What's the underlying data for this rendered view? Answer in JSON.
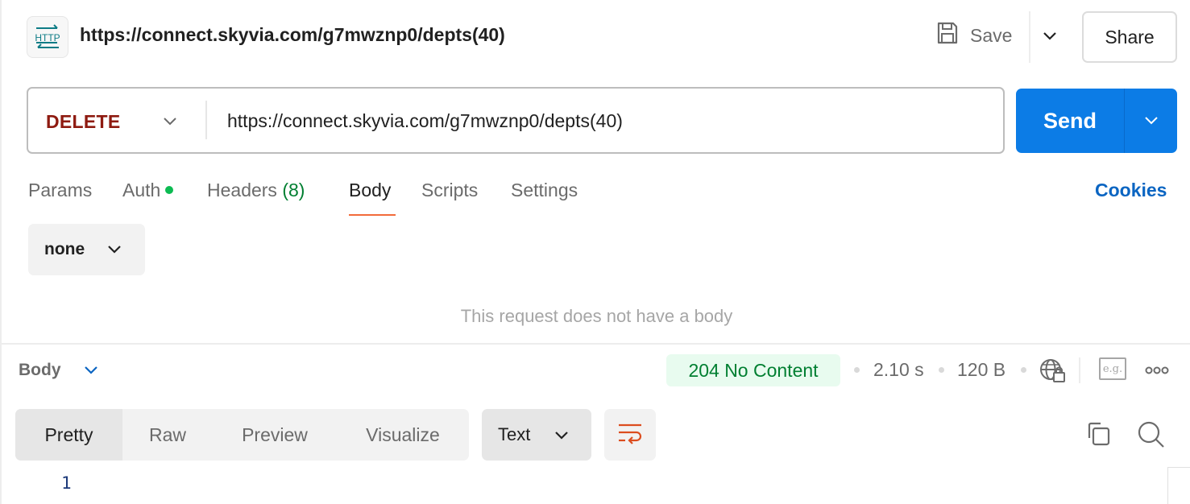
{
  "header": {
    "icon_label": "HTTP",
    "title": "https://connect.skyvia.com/g7mwznp0/depts(40)",
    "save_label": "Save",
    "share_label": "Share"
  },
  "request": {
    "method": "DELETE",
    "url": "https://connect.skyvia.com/g7mwznp0/depts(40)",
    "send_label": "Send"
  },
  "tabs": [
    {
      "label": "Params"
    },
    {
      "label": "Auth",
      "indicator": "green-dot"
    },
    {
      "label": "Headers",
      "count": "(8)"
    },
    {
      "label": "Body",
      "active": true
    },
    {
      "label": "Scripts"
    },
    {
      "label": "Settings"
    }
  ],
  "cookies_label": "Cookies",
  "body_type": {
    "selected": "none",
    "empty_message": "This request does not have a body"
  },
  "response": {
    "section_label": "Body",
    "status": "204 No Content",
    "time": "2.10 s",
    "size": "120 B",
    "view_tabs": [
      {
        "label": "Pretty",
        "active": true
      },
      {
        "label": "Raw"
      },
      {
        "label": "Preview"
      },
      {
        "label": "Visualize"
      }
    ],
    "format": "Text",
    "example_label": "e.g.",
    "lines": [
      "1"
    ]
  },
  "colors": {
    "method_delete": "#8e1a10",
    "send_button": "#0c7ce6",
    "active_tab_underline": "#f26b3a",
    "status_ok_text": "#007f31",
    "status_ok_bg": "#e8fbef",
    "cookies_link": "#0b65c2",
    "auth_dot": "#0cbb52"
  }
}
